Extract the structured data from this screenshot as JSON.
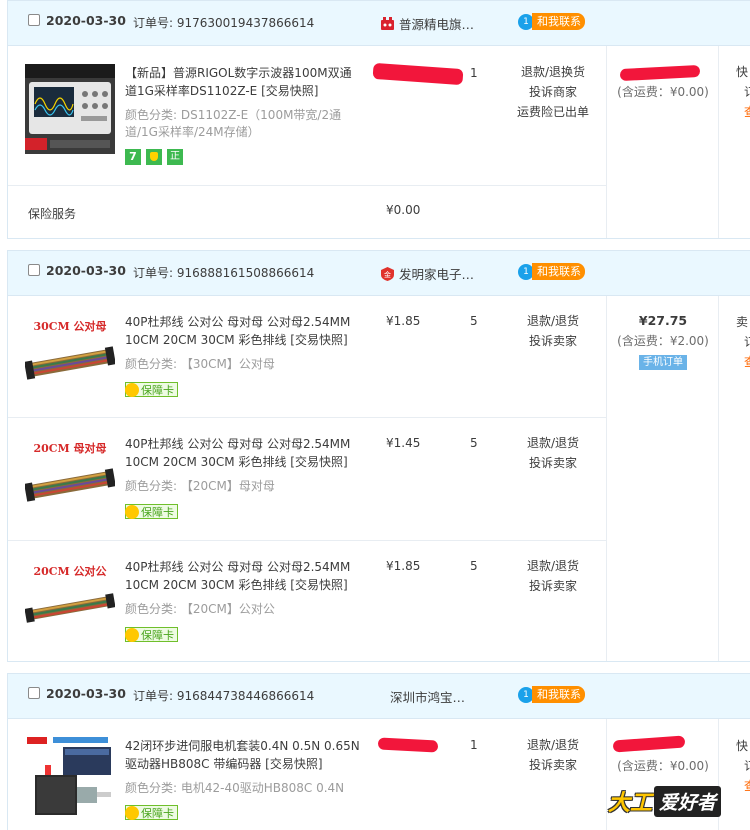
{
  "orders": [
    {
      "date": "2020-03-30",
      "order_no": "订单号: 917630019437866614",
      "shop": "普源精电旗…",
      "contact": "和我联系",
      "items": [
        {
          "title": "【新品】普源RIGOL数字示波器100M双通道1G采样率DS1102Z-E [交易快照]",
          "spec": "颜色分类: DS1102Z-E（100M带宽/2通道/1G采样率/24M存储）",
          "qty": "1",
          "ops": [
            "退款/退换货",
            "投诉商家",
            "运费险已出单"
          ],
          "badges": [
            "7",
            "shield",
            "正"
          ]
        }
      ],
      "insurance": {
        "label": "保险服务",
        "price": "¥0.00"
      },
      "total": {
        "shipping": "(含运费：¥0.00)"
      },
      "status": [
        "快",
        "订",
        "查"
      ]
    },
    {
      "date": "2020-03-30",
      "order_no": "订单号: 916888161508866614",
      "shop": "发明家电子…",
      "contact": "和我联系",
      "items": [
        {
          "thumb_label": "30CM 公对母",
          "title": "40P杜邦线 公对公 母对母 公对母2.54MM 10CM 20CM 30CM 彩色排线 [交易快照]",
          "spec": "颜色分类: 【30CM】公对母",
          "price": "¥1.85",
          "qty": "5",
          "ops": [
            "退款/退货",
            "投诉卖家"
          ],
          "badge": "保障卡"
        },
        {
          "thumb_label": "20CM 母对母",
          "title": "40P杜邦线 公对公 母对母 公对母2.54MM 10CM 20CM 30CM 彩色排线 [交易快照]",
          "spec": "颜色分类: 【20CM】母对母",
          "price": "¥1.45",
          "qty": "5",
          "ops": [
            "退款/退货",
            "投诉卖家"
          ],
          "badge": "保障卡"
        },
        {
          "thumb_label": "20CM 公对公",
          "title": "40P杜邦线 公对公 母对母 公对母2.54MM 10CM 20CM 30CM 彩色排线 [交易快照]",
          "spec": "颜色分类: 【20CM】公对公",
          "price": "¥1.85",
          "qty": "5",
          "ops": [
            "退款/退货",
            "投诉卖家"
          ],
          "badge": "保障卡"
        }
      ],
      "total": {
        "amount": "¥27.75",
        "shipping": "(含运费：¥2.00)",
        "mobile": "手机订单"
      },
      "status": [
        "卖",
        "订",
        "查"
      ]
    },
    {
      "date": "2020-03-30",
      "order_no": "订单号: 916844738446866614",
      "shop": "深圳市鸿宝…",
      "contact": "和我联系",
      "items": [
        {
          "title": "42闭环步进伺服电机套装0.4N 0.5N 0.65N 驱动器HB808C 带编码器 [交易快照]",
          "spec": "颜色分类: 电机42-40驱动HB808C 0.4N",
          "qty": "1",
          "ops": [
            "退款/退货",
            "投诉卖家"
          ],
          "badge": "保障卡"
        }
      ],
      "total": {
        "shipping": "(含运费：¥0.00)"
      },
      "status": [
        "快",
        "订",
        "查"
      ]
    }
  ],
  "watermark": {
    "part1": "大工",
    "part2": "爱好者"
  },
  "colors": {
    "header_bg": "#eaf8ff",
    "border": "#d9e8f3",
    "contact_orange": "#ff8f00",
    "chat_blue": "#1aa1ea",
    "redact_red": "#f2163b",
    "badge_green": "#3db950"
  }
}
